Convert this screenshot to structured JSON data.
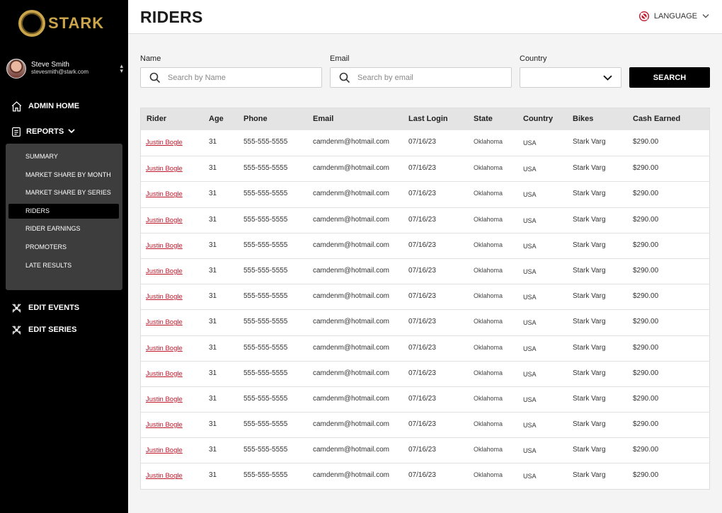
{
  "brand": {
    "name": "STARK"
  },
  "user": {
    "name": "Steve Smith",
    "email": "stevesmith@stark.com"
  },
  "nav": {
    "admin_home": "ADMIN HOME",
    "reports": "REPORTS",
    "edit_events": "EDIT EVENTS",
    "edit_series": "EDIT SERIES",
    "submenu": [
      "SUMMARY",
      "MARKET SHARE BY MONTH",
      "MARKET SHARE BY SERIES",
      "RIDERS",
      "RIDER EARNINGS",
      "PROMOTERS",
      "LATE RESULTS"
    ],
    "active": "RIDERS"
  },
  "header": {
    "title": "RIDERS",
    "language": "LANGUAGE"
  },
  "filters": {
    "name_label": "Name",
    "name_placeholder": "Search by Name",
    "email_label": "Email",
    "email_placeholder": "Search by email",
    "country_label": "Country",
    "country_value": "",
    "search_button": "SEARCH"
  },
  "table": {
    "columns": [
      "Rider",
      "Age",
      "Phone",
      "Email",
      "Last Login",
      "State",
      "Country",
      "Bikes",
      "Cash Earned"
    ],
    "rows": [
      [
        "Justin Bogle",
        "31",
        "555-555-5555",
        "camdenm@hotmail.com",
        "07/16/23",
        "Oklahoma",
        "USA",
        "Stark Varg",
        "$290.00"
      ],
      [
        "Justin Bogle",
        "31",
        "555-555-5555",
        "camdenm@hotmail.com",
        "07/16/23",
        "Oklahoma",
        "USA",
        "Stark Varg",
        "$290.00"
      ],
      [
        "Justin Bogle",
        "31",
        "555-555-5555",
        "camdenm@hotmail.com",
        "07/16/23",
        "Oklahoma",
        "USA",
        "Stark Varg",
        "$290.00"
      ],
      [
        "Justin Bogle",
        "31",
        "555-555-5555",
        "camdenm@hotmail.com",
        "07/16/23",
        "Oklahoma",
        "USA",
        "Stark Varg",
        "$290.00"
      ],
      [
        "Justin Bogle",
        "31",
        "555-555-5555",
        "camdenm@hotmail.com",
        "07/16/23",
        "Oklahoma",
        "USA",
        "Stark Varg",
        "$290.00"
      ],
      [
        "Justin Bogle",
        "31",
        "555-555-5555",
        "camdenm@hotmail.com",
        "07/16/23",
        "Oklahoma",
        "USA",
        "Stark Varg",
        "$290.00"
      ],
      [
        "Justin Bogle",
        "31",
        "555-555-5555",
        "camdenm@hotmail.com",
        "07/16/23",
        "Oklahoma",
        "USA",
        "Stark Varg",
        "$290.00"
      ],
      [
        "Justin Bogle",
        "31",
        "555-555-5555",
        "camdenm@hotmail.com",
        "07/16/23",
        "Oklahoma",
        "USA",
        "Stark Varg",
        "$290.00"
      ],
      [
        "Justin Bogle",
        "31",
        "555-555-5555",
        "camdenm@hotmail.com",
        "07/16/23",
        "Oklahoma",
        "USA",
        "Stark Varg",
        "$290.00"
      ],
      [
        "Justin Bogle",
        "31",
        "555-555-5555",
        "camdenm@hotmail.com",
        "07/16/23",
        "Oklahoma",
        "USA",
        "Stark Varg",
        "$290.00"
      ],
      [
        "Justin Bogle",
        "31",
        "555-555-5555",
        "camdenm@hotmail.com",
        "07/16/23",
        "Oklahoma",
        "USA",
        "Stark Varg",
        "$290.00"
      ],
      [
        "Justin Bogle",
        "31",
        "555-555-5555",
        "camdenm@hotmail.com",
        "07/16/23",
        "Oklahoma",
        "USA",
        "Stark Varg",
        "$290.00"
      ],
      [
        "Justin Bogle",
        "31",
        "555-555-5555",
        "camdenm@hotmail.com",
        "07/16/23",
        "Oklahoma",
        "USA",
        "Stark Varg",
        "$290.00"
      ],
      [
        "Justin Bogle",
        "31",
        "555-555-5555",
        "camdenm@hotmail.com",
        "07/16/23",
        "Oklahoma",
        "USA",
        "Stark Varg",
        "$290.00"
      ]
    ]
  },
  "colors": {
    "accent_gold": "#c9a44a",
    "link_red": "#c0182c",
    "sidebar_bg": "#000000",
    "submenu_bg": "#3d3d3d"
  },
  "icons": [
    "home-icon",
    "reports-icon",
    "chevron-down-icon",
    "edit-events-icon",
    "edit-series-icon",
    "globe-flag-icon",
    "search-icon"
  ]
}
